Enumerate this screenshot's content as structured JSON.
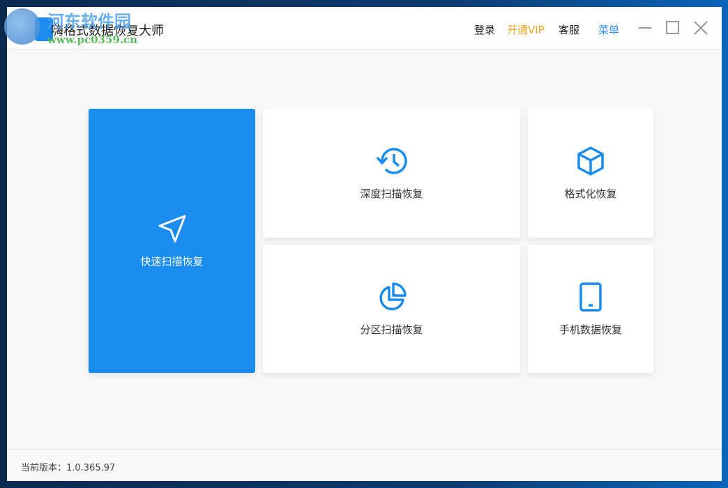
{
  "window": {
    "title": "嗨格式数据恢复大师"
  },
  "watermark": {
    "name": "河东软件园",
    "url": "www.pc0359.cn"
  },
  "header": {
    "login": "登录",
    "vip": "开通VIP",
    "service": "客服",
    "menu": "菜单"
  },
  "colors": {
    "accent": "#1b8cef",
    "vip": "#f5a623",
    "menu": "#2b8ef0"
  },
  "cards": [
    {
      "label": "快速扫描恢复",
      "icon": "navigation-arrow-icon"
    },
    {
      "label": "深度扫描恢复",
      "icon": "history-clock-icon"
    },
    {
      "label": "格式化恢复",
      "icon": "cube-icon"
    },
    {
      "label": "分区扫描恢复",
      "icon": "pie-chart-icon"
    },
    {
      "label": "手机数据恢复",
      "icon": "tablet-icon"
    }
  ],
  "footer": {
    "version": "当前版本：1.0.365.97"
  }
}
